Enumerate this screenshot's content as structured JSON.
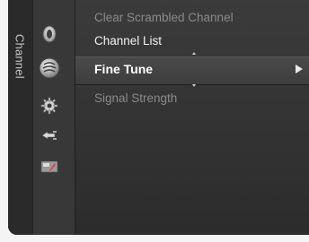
{
  "sidebar": {
    "tab_label": "Channel",
    "icons": [
      "picture-icon",
      "channel-icon",
      "setup-icon",
      "input-icon",
      "application-icon"
    ]
  },
  "menu": {
    "items": [
      {
        "label": "Clear Scrambled Channel",
        "state": "dim"
      },
      {
        "label": "Channel List",
        "state": "normal"
      },
      {
        "label": "Fine Tune",
        "state": "selected",
        "has_submenu": true
      },
      {
        "label": "Signal Strength",
        "state": "dim"
      }
    ]
  },
  "colors": {
    "panel_bg": "#353535",
    "selected_text": "#ffffff",
    "dim_text": "#8a8a8a",
    "normal_text": "#f2f2f2"
  }
}
